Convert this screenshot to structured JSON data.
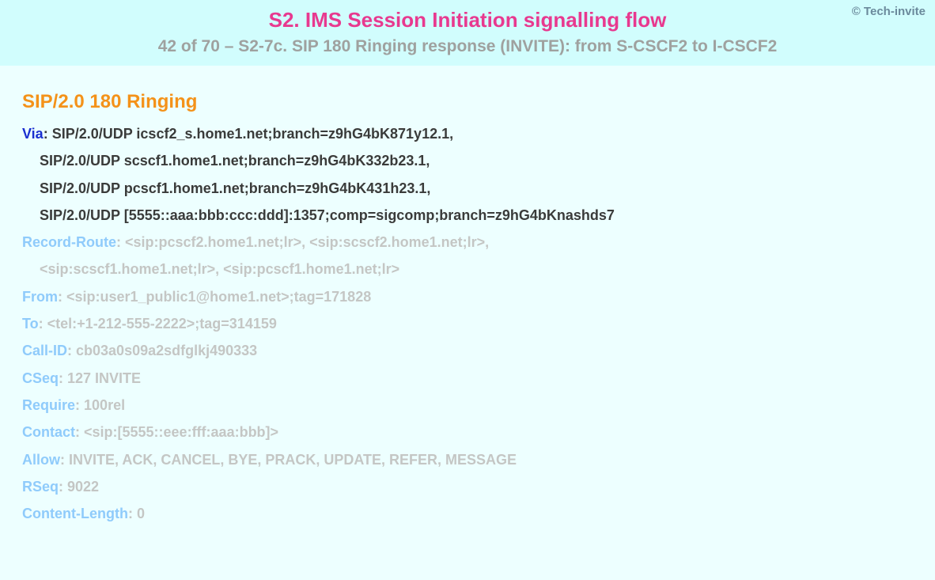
{
  "copyright": "© Tech-invite",
  "header": {
    "title": "S2. IMS Session Initiation signalling flow",
    "subtitle": "42 of 70 – S2-7c. SIP 180 Ringing response (INVITE): from S-CSCF2 to I-CSCF2"
  },
  "status_line": "SIP/2.0 180 Ringing",
  "via": {
    "label": "Via",
    "line1": "SIP/2.0/UDP icscf2_s.home1.net;branch=z9hG4bK871y12.1,",
    "line2": "SIP/2.0/UDP scscf1.home1.net;branch=z9hG4bK332b23.1,",
    "line3": "SIP/2.0/UDP pcscf1.home1.net;branch=z9hG4bK431h23.1,",
    "line4": "SIP/2.0/UDP [5555::aaa:bbb:ccc:ddd]:1357;comp=sigcomp;branch=z9hG4bKnashds7"
  },
  "record_route": {
    "label": "Record-Route",
    "line1": "<sip:pcscf2.home1.net;lr>, <sip:scscf2.home1.net;lr>,",
    "line2": "<sip:scscf1.home1.net;lr>, <sip:pcscf1.home1.net;lr>"
  },
  "from": {
    "label": "From",
    "value": "<sip:user1_public1@home1.net>;tag=171828"
  },
  "to": {
    "label": "To",
    "value": "<tel:+1-212-555-2222>;tag=314159"
  },
  "callid": {
    "label": "Call-ID",
    "value": "cb03a0s09a2sdfglkj490333"
  },
  "cseq": {
    "label": "CSeq",
    "value": "127 INVITE"
  },
  "require": {
    "label": "Require",
    "value": "100rel"
  },
  "contact": {
    "label": "Contact",
    "value": "<sip:[5555::eee:fff:aaa:bbb]>"
  },
  "allow": {
    "label": "Allow",
    "value": "INVITE, ACK, CANCEL, BYE, PRACK, UPDATE, REFER, MESSAGE"
  },
  "rseq": {
    "label": "RSeq",
    "value": "9022"
  },
  "clen": {
    "label": "Content-Length",
    "value": "0"
  },
  "sep": ": "
}
